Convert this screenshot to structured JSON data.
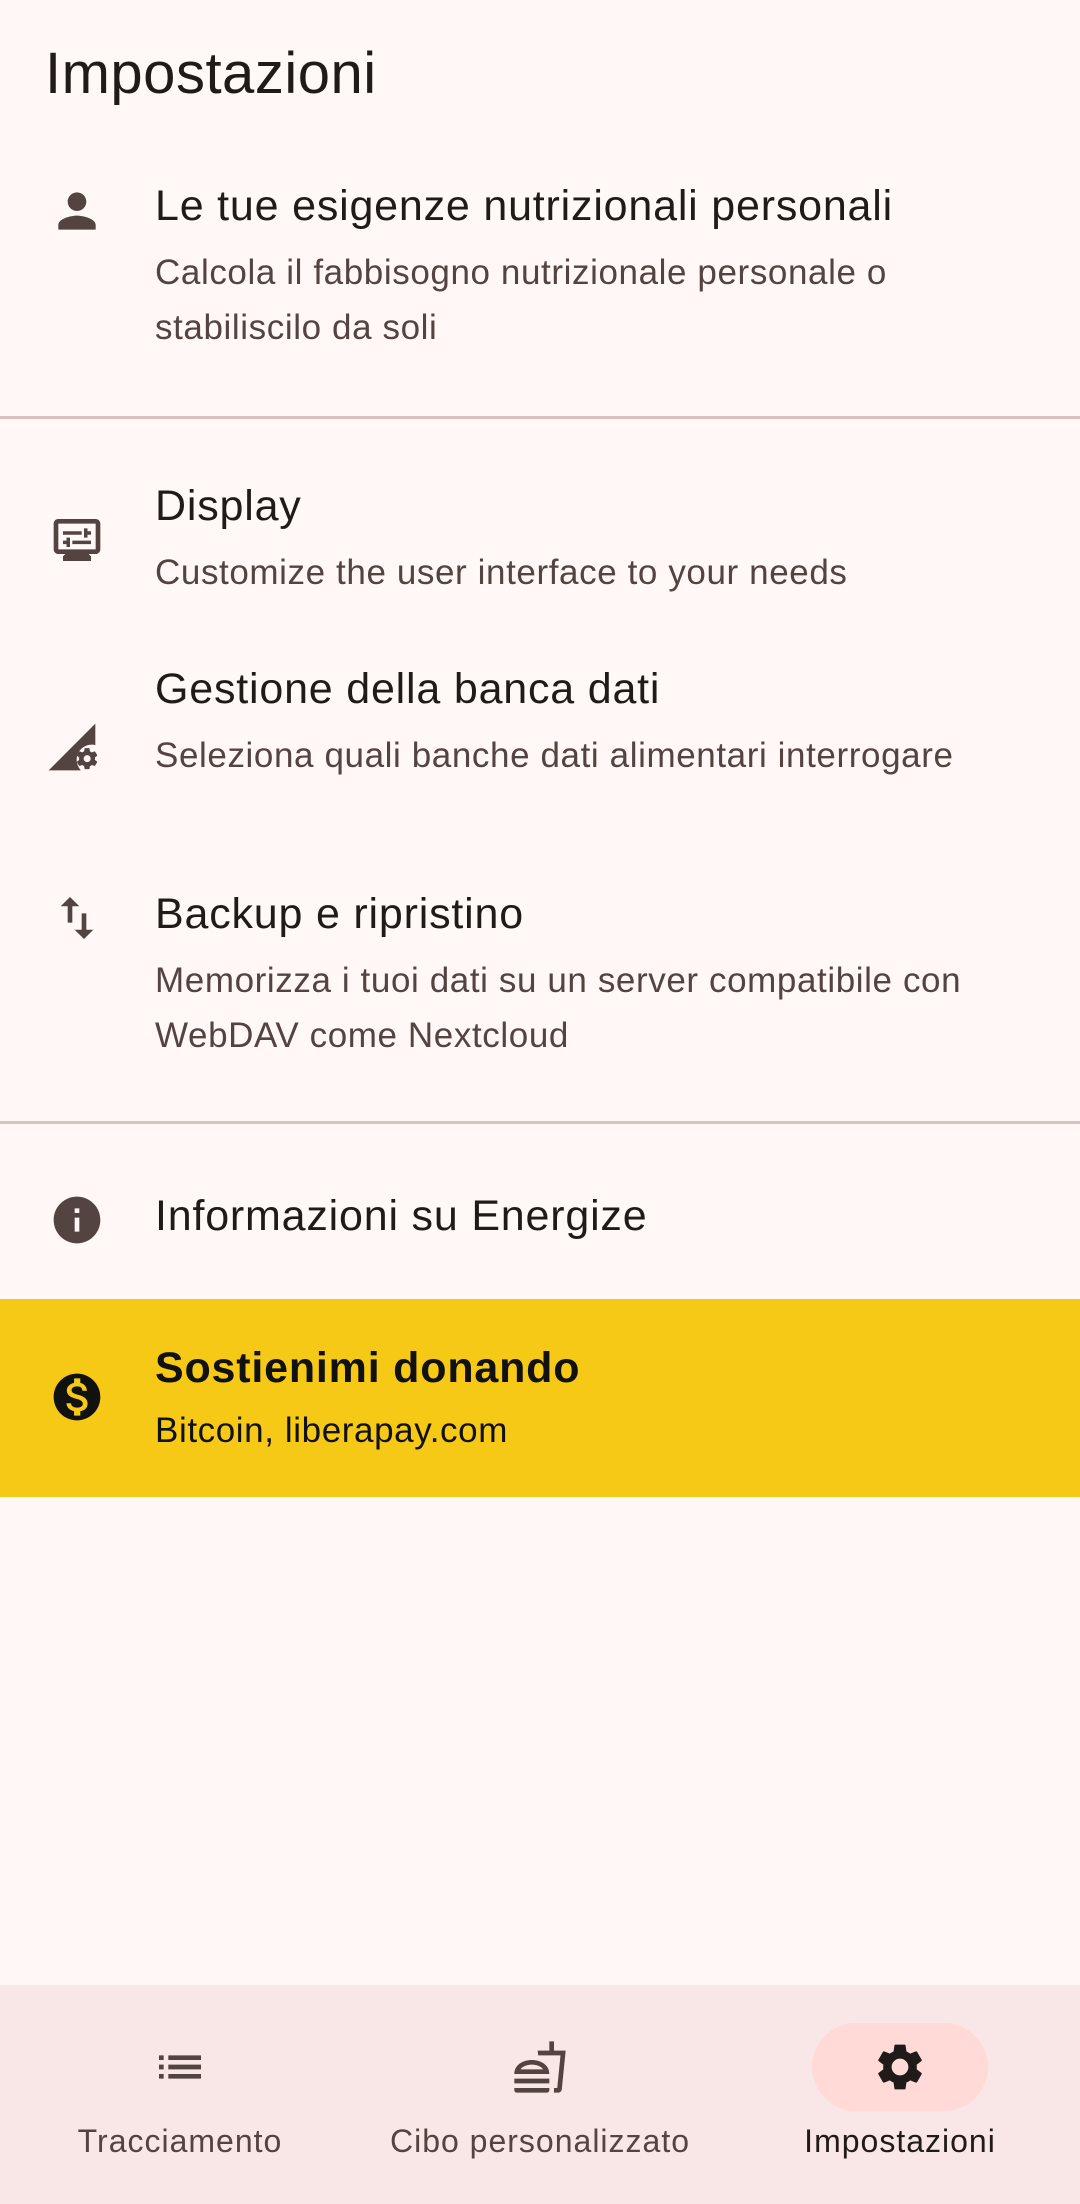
{
  "page_title": "Impostazioni",
  "settings": {
    "nutrition": {
      "icon": "person-icon",
      "title": "Le tue esigenze nutrizionali personali",
      "subtitle": "Calcola il fabbisogno nutrizionale personale o stabiliscilo da soli"
    },
    "display": {
      "icon": "display-settings-icon",
      "title": "Display",
      "subtitle": "Customize the user interface to your needs"
    },
    "database": {
      "icon": "signal-cellular-gear-icon",
      "title": "Gestione della banca dati",
      "subtitle": "Seleziona quali banche dati alimentari interrogare"
    },
    "backup": {
      "icon": "swap-vertical-icon",
      "title": "Backup e ripristino",
      "subtitle": "Memorizza i tuoi dati su un server compatibile con WebDAV come Nextcloud"
    },
    "about": {
      "icon": "info-icon",
      "title": "Informazioni su Energize"
    },
    "donate": {
      "icon": "dollar-circle-icon",
      "title": "Sostienimi donando",
      "subtitle": "Bitcoin, liberapay.com",
      "background": "#f5c916"
    }
  },
  "bottom_nav": {
    "items": [
      {
        "label": "Tracciamento",
        "icon": "list-icon",
        "active": false
      },
      {
        "label": "Cibo personalizzato",
        "icon": "fastfood-icon",
        "active": false
      },
      {
        "label": "Impostazioni",
        "icon": "gear-icon",
        "active": true
      }
    ]
  },
  "colors": {
    "background": "#fff8f6",
    "icon": "#534341",
    "divider": "#d8c2bf",
    "nav_background": "#f9e6e6",
    "active_pill": "#ffdad6",
    "donate_background": "#f5c916"
  }
}
